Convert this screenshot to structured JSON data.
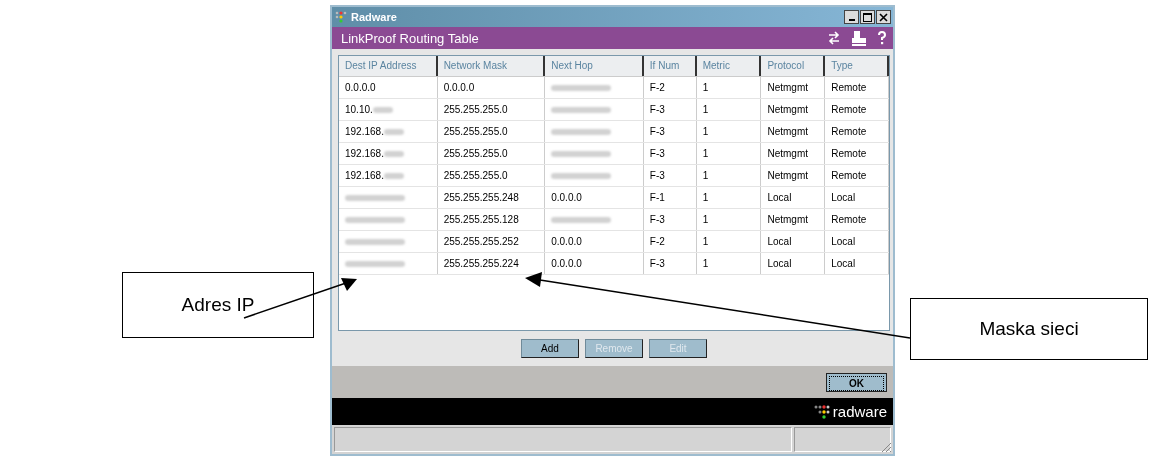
{
  "window": {
    "title": "Radware",
    "header": "LinkProof Routing Table"
  },
  "table": {
    "columns": [
      "Dest IP Address",
      "Network Mask",
      "Next Hop",
      "If Num",
      "Metric",
      "Protocol",
      "Type"
    ],
    "rows": [
      [
        {
          "text": "0.0.0.0"
        },
        {
          "text": "0.0.0.0"
        },
        {
          "redacted": true
        },
        {
          "text": "F-2"
        },
        {
          "text": "1"
        },
        {
          "text": "Netmgmt"
        },
        {
          "text": "Remote"
        }
      ],
      [
        {
          "text": "10.10.",
          "redacted": true
        },
        {
          "text": "255.255.255.0"
        },
        {
          "redacted": true
        },
        {
          "text": "F-3"
        },
        {
          "text": "1"
        },
        {
          "text": "Netmgmt"
        },
        {
          "text": "Remote"
        }
      ],
      [
        {
          "text": "192.168.",
          "redacted": true
        },
        {
          "text": "255.255.255.0"
        },
        {
          "redacted": true
        },
        {
          "text": "F-3"
        },
        {
          "text": "1"
        },
        {
          "text": "Netmgmt"
        },
        {
          "text": "Remote"
        }
      ],
      [
        {
          "text": "192.168.",
          "redacted": true
        },
        {
          "text": "255.255.255.0"
        },
        {
          "redacted": true
        },
        {
          "text": "F-3"
        },
        {
          "text": "1"
        },
        {
          "text": "Netmgmt"
        },
        {
          "text": "Remote"
        }
      ],
      [
        {
          "text": "192.168.",
          "redacted": true
        },
        {
          "text": "255.255.255.0"
        },
        {
          "redacted": true
        },
        {
          "text": "F-3"
        },
        {
          "text": "1"
        },
        {
          "text": "Netmgmt"
        },
        {
          "text": "Remote"
        }
      ],
      [
        {
          "redacted": true
        },
        {
          "text": "255.255.255.248"
        },
        {
          "text": "0.0.0.0"
        },
        {
          "text": "F-1"
        },
        {
          "text": "1"
        },
        {
          "text": "Local"
        },
        {
          "text": "Local"
        }
      ],
      [
        {
          "redacted": true
        },
        {
          "text": "255.255.255.128"
        },
        {
          "redacted": true
        },
        {
          "text": "F-3"
        },
        {
          "text": "1"
        },
        {
          "text": "Netmgmt"
        },
        {
          "text": "Remote"
        }
      ],
      [
        {
          "redacted": true
        },
        {
          "text": "255.255.255.252"
        },
        {
          "text": "0.0.0.0"
        },
        {
          "text": "F-2"
        },
        {
          "text": "1"
        },
        {
          "text": "Local"
        },
        {
          "text": "Local"
        }
      ],
      [
        {
          "redacted": true
        },
        {
          "text": "255.255.255.224"
        },
        {
          "text": "0.0.0.0"
        },
        {
          "text": "F-3"
        },
        {
          "text": "1"
        },
        {
          "text": "Local"
        },
        {
          "text": "Local"
        }
      ]
    ]
  },
  "buttons": [
    {
      "label": "Add",
      "disabled": false
    },
    {
      "label": "Remove",
      "disabled": true
    },
    {
      "label": "Edit",
      "disabled": true
    }
  ],
  "ok_button": "OK",
  "brand": "radware",
  "annotations": [
    {
      "label": "Adres IP"
    },
    {
      "label": "Maska sieci"
    }
  ]
}
